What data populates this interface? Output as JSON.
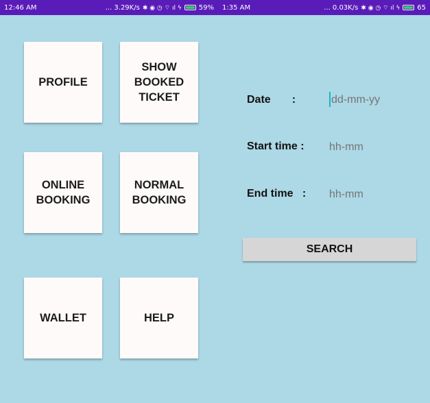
{
  "status_left": {
    "time": "12:46 AM",
    "network": "... 3.29K/s",
    "icons": "✱ ◉ ◷ ⌔ ıl ϟ",
    "battery": "59%",
    "battery_level": 59,
    "battery_color": "#34d16a"
  },
  "status_right": {
    "time": "1:35 AM",
    "network": "... 0.03K/s",
    "icons": "✱ ◉ ◷ ⌔ ıl ϟ",
    "battery": "65",
    "battery_level": 65,
    "battery_color": "#34d16a"
  },
  "tiles": {
    "profile": "PROFILE",
    "show_booked_ticket": "SHOW\nBOOKED\nTICKET",
    "online_booking": "ONLINE\nBOOKING",
    "normal_booking": "NORMAL\nBOOKING",
    "wallet": "WALLET",
    "help": "HELP"
  },
  "form": {
    "date_label": "Date       :",
    "date_placeholder": "dd-mm-yy",
    "start_label": "Start time :",
    "start_placeholder": "hh-mm",
    "end_label": "End time   :",
    "end_placeholder": "hh-mm",
    "search_label": "SEARCH"
  },
  "colors": {
    "background": "#add8e6",
    "status_bar": "#5a1cb8",
    "tile": "#fffafa",
    "button": "#d6d6d6",
    "cursor": "#16b7c4"
  }
}
